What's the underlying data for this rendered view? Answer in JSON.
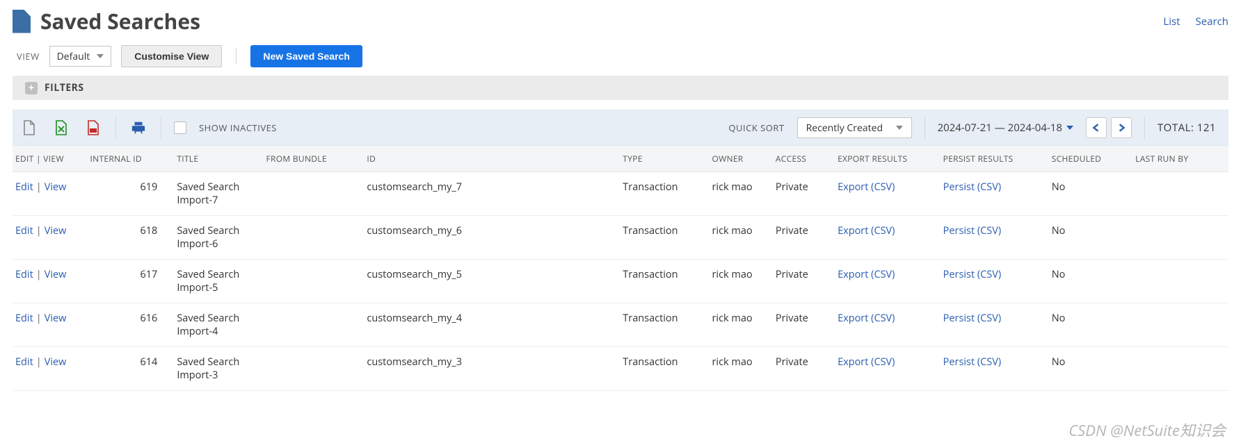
{
  "header": {
    "title": "Saved Searches",
    "top_links": {
      "list": "List",
      "search": "Search"
    }
  },
  "actions": {
    "view_label": "VIEW",
    "view_value": "Default",
    "customise": "Customise View",
    "new_search": "New Saved Search"
  },
  "filters": {
    "label": "FILTERS"
  },
  "toolbar": {
    "show_inactives": "SHOW INACTIVES",
    "quick_sort_label": "QUICK SORT",
    "quick_sort_value": "Recently Created",
    "date_range": "2024-07-21 — 2024-04-18",
    "total_label": "TOTAL:",
    "total_value": "121"
  },
  "columns": {
    "edit_view": "EDIT | VIEW",
    "internal_id": "INTERNAL ID",
    "title": "TITLE",
    "from_bundle": "FROM BUNDLE",
    "id": "ID",
    "type": "TYPE",
    "owner": "OWNER",
    "access": "ACCESS",
    "export_results": "EXPORT RESULTS",
    "persist_results": "PERSIST RESULTS",
    "scheduled": "SCHEDULED",
    "last_run_by": "LAST RUN BY"
  },
  "row_labels": {
    "edit": "Edit",
    "view": "View",
    "export": "Export (CSV)",
    "persist": "Persist (CSV)"
  },
  "rows": [
    {
      "internal_id": "619",
      "title": "Saved Search Import-7",
      "from_bundle": "",
      "id": "customsearch_my_7",
      "type": "Transaction",
      "owner": "rick mao",
      "access": "Private",
      "scheduled": "No",
      "last_run_by": ""
    },
    {
      "internal_id": "618",
      "title": "Saved Search Import-6",
      "from_bundle": "",
      "id": "customsearch_my_6",
      "type": "Transaction",
      "owner": "rick mao",
      "access": "Private",
      "scheduled": "No",
      "last_run_by": ""
    },
    {
      "internal_id": "617",
      "title": "Saved Search Import-5",
      "from_bundle": "",
      "id": "customsearch_my_5",
      "type": "Transaction",
      "owner": "rick mao",
      "access": "Private",
      "scheduled": "No",
      "last_run_by": ""
    },
    {
      "internal_id": "616",
      "title": "Saved Search Import-4",
      "from_bundle": "",
      "id": "customsearch_my_4",
      "type": "Transaction",
      "owner": "rick mao",
      "access": "Private",
      "scheduled": "No",
      "last_run_by": ""
    },
    {
      "internal_id": "614",
      "title": "Saved Search Import-3",
      "from_bundle": "",
      "id": "customsearch_my_3",
      "type": "Transaction",
      "owner": "rick mao",
      "access": "Private",
      "scheduled": "No",
      "last_run_by": ""
    }
  ],
  "watermark": "CSDN @NetSuite知识会"
}
